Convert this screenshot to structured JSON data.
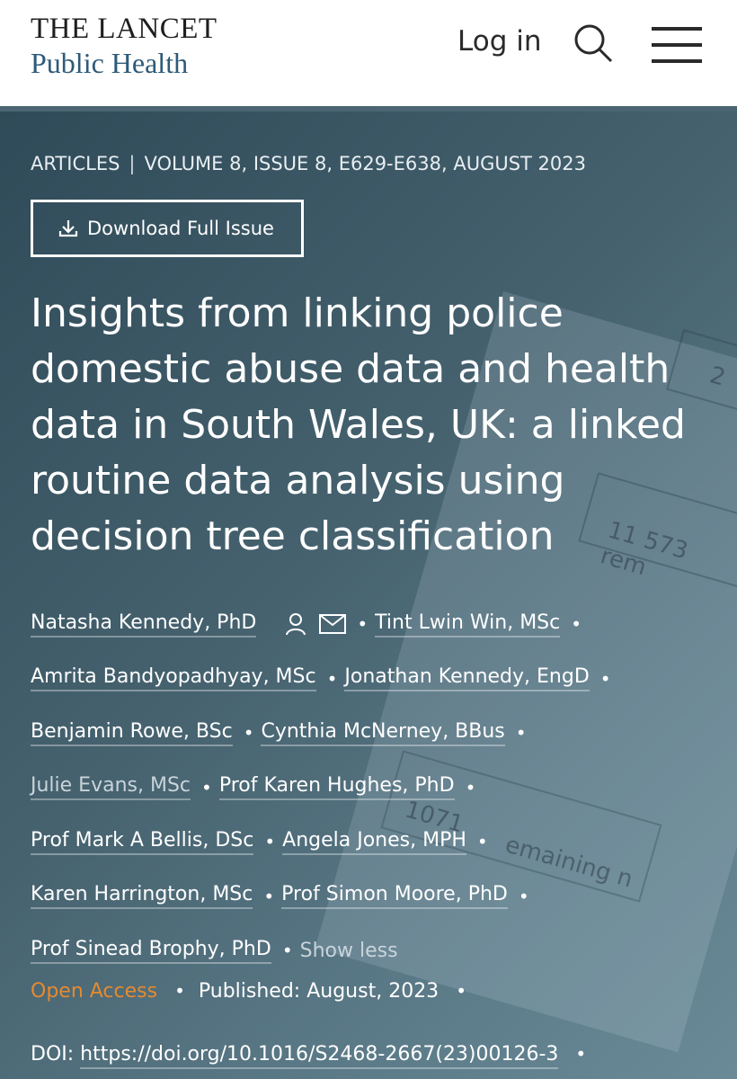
{
  "header": {
    "logo_line1": "THE LANCET",
    "logo_line2": "Public Health",
    "login_label": "Log in",
    "icons": [
      "search-icon",
      "menu-icon"
    ]
  },
  "breadcrumb": {
    "section": "ARTICLES",
    "separator": "|",
    "volume": "VOLUME 8, ISSUE 8, E629-E638, AUGUST 2023"
  },
  "download_button": "Download Full Issue",
  "title": "Insights from linking police domestic abuse data and health data in South Wales, UK: a linked routine data analysis using decision tree classification",
  "authors": [
    "Natasha Kennedy, PhD",
    "Tint Lwin Win, MSc",
    "Amrita Bandyopadhyay, MSc",
    "Jonathan Kennedy, EngD",
    "Benjamin Rowe, BSc",
    "Cynthia McNerney, BBus",
    "Julie Evans, MSc",
    "Prof Karen Hughes, PhD",
    "Prof Mark A Bellis, DSc",
    "Angela Jones, MPH",
    "Karen Harrington, MSc",
    "Prof Simon Moore, PhD",
    "Prof Sinead Brophy, PhD"
  ],
  "show_less": "Show less",
  "access": "Open Access",
  "published_label": "Published:",
  "published_date": "August, 2023",
  "doi_label": "DOI:",
  "doi": "https://doi.org/10.1016/S2468-2667(23)00126-3",
  "background_text": [
    "2",
    "11 573 rem",
    "1071",
    "emaining n"
  ],
  "colors": {
    "accent_orange": "#e58a2e",
    "hero_bg": "#46626f",
    "logo_blue": "#2e5a78"
  }
}
